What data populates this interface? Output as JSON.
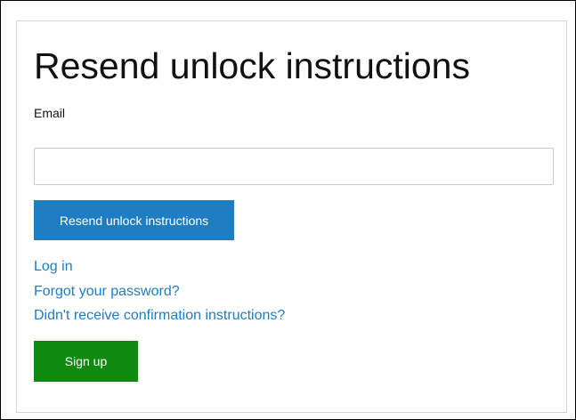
{
  "form": {
    "title": "Resend unlock instructions",
    "email_label": "Email",
    "email_value": "",
    "submit_label": "Resend unlock instructions"
  },
  "links": {
    "login": "Log in",
    "forgot_password": "Forgot your password?",
    "confirmation": "Didn't receive confirmation instructions?"
  },
  "signup": {
    "label": "Sign up"
  },
  "colors": {
    "primary_button": "#1f7dc2",
    "link": "#1f7dc2",
    "signup_button": "#0f8a0f"
  }
}
